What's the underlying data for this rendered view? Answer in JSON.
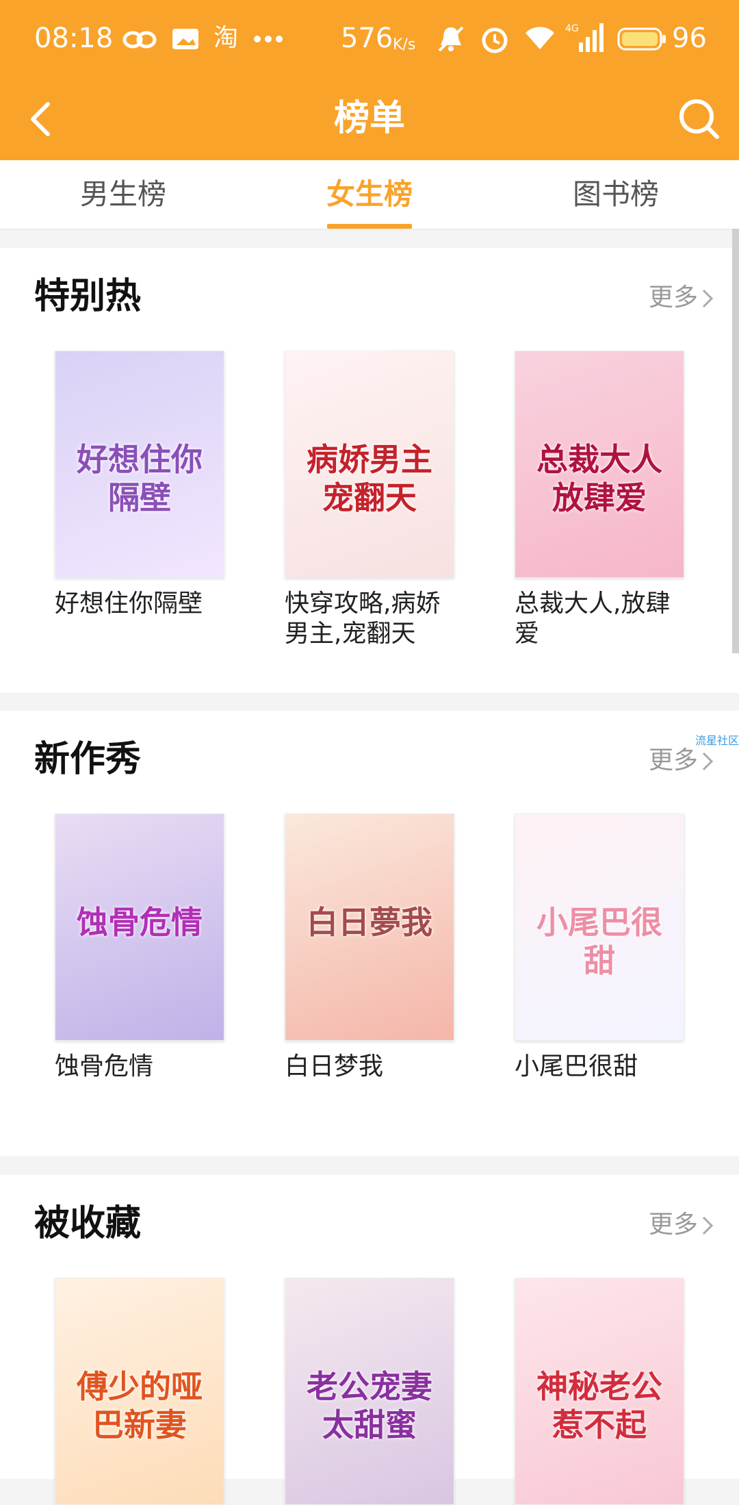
{
  "status": {
    "time": "08:18",
    "net_speed": "576",
    "net_unit": "K/s",
    "battery": "96"
  },
  "header": {
    "title": "榜单"
  },
  "tabs": [
    {
      "label": "男生榜",
      "active": false
    },
    {
      "label": "女生榜",
      "active": true
    },
    {
      "label": "图书榜",
      "active": false
    }
  ],
  "sections": [
    {
      "title": "特别热",
      "more": "更多",
      "books": [
        {
          "name": "好想住你隔壁",
          "cover_text": "好想住你隔壁",
          "cover_colors": [
            "#d9d2f5",
            "#f2e6ff"
          ],
          "text_color": "#8a4fb8"
        },
        {
          "name": "快穿攻略,病娇男主,宠翻天",
          "cover_text": "病娇男主宠翻天",
          "cover_colors": [
            "#fff3f3",
            "#f7e1e1"
          ],
          "text_color": "#c4222b"
        },
        {
          "name": "总裁大人,放肆爱",
          "cover_text": "总裁大人放肆爱",
          "cover_colors": [
            "#f9d2de",
            "#f6b6c9"
          ],
          "text_color": "#b0123f"
        }
      ]
    },
    {
      "title": "新作秀",
      "more": "更多",
      "books": [
        {
          "name": "蚀骨危情",
          "cover_text": "蚀骨危情",
          "cover_colors": [
            "#e9dcf4",
            "#bfb2e8"
          ],
          "text_color": "#b12fb7"
        },
        {
          "name": "白日梦我",
          "cover_text": "白日夢我",
          "cover_colors": [
            "#fbe8dc",
            "#f4b6a9"
          ],
          "text_color": "#a44b4b"
        },
        {
          "name": "小尾巴很甜",
          "cover_text": "小尾巴很甜",
          "cover_colors": [
            "#fdf2f5",
            "#f4f4ff"
          ],
          "text_color": "#ee8ea5"
        }
      ]
    },
    {
      "title": "被收藏",
      "more": "更多",
      "books": [
        {
          "name": "",
          "cover_text": "傅少的哑巴新妻",
          "cover_colors": [
            "#fff1e2",
            "#fddcb8"
          ],
          "text_color": "#e0541f"
        },
        {
          "name": "",
          "cover_text": "老公宠妻太甜蜜",
          "cover_colors": [
            "#f5e9ef",
            "#d8c6e2"
          ],
          "text_color": "#8a2fa0"
        },
        {
          "name": "",
          "cover_text": "神秘老公惹不起",
          "cover_colors": [
            "#fde6ea",
            "#f8c8d4"
          ],
          "text_color": "#d32c3c"
        }
      ]
    }
  ],
  "side_tag": "流星社区"
}
